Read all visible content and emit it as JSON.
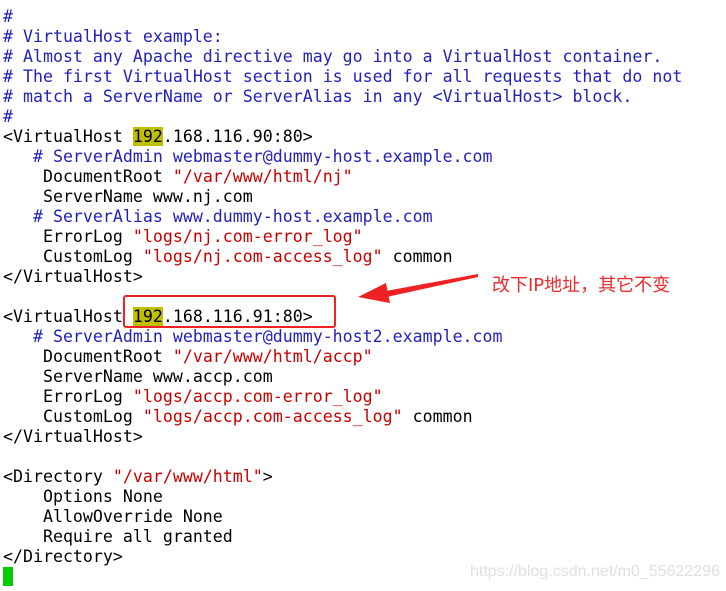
{
  "colors": {
    "comment": "#2222bb",
    "string": "#c80000",
    "highlight": "#c0c000",
    "cursor": "#00cc00",
    "annotation": "#ee2222"
  },
  "editor": {
    "lines": [
      [
        {
          "t": "#",
          "c": "comment"
        }
      ],
      [
        {
          "t": "# VirtualHost example:",
          "c": "comment"
        }
      ],
      [
        {
          "t": "# Almost any Apache directive may go into a VirtualHost container.",
          "c": "comment"
        }
      ],
      [
        {
          "t": "# The first VirtualHost section is used for all requests that do not",
          "c": "comment"
        }
      ],
      [
        {
          "t": "# match a ServerName or ServerAlias in any <VirtualHost> block.",
          "c": "comment"
        }
      ],
      [
        {
          "t": "#",
          "c": "comment"
        }
      ],
      [
        {
          "t": "<VirtualHost ",
          "c": "normal"
        },
        {
          "t": "192",
          "c": "hl"
        },
        {
          "t": ".168.116.90:80>",
          "c": "normal"
        }
      ],
      [
        {
          "t": "   # ServerAdmin webmaster@dummy-host.example.com",
          "c": "comment"
        }
      ],
      [
        {
          "t": "    DocumentRoot ",
          "c": "normal"
        },
        {
          "t": "\"/var/www/html/nj\"",
          "c": "string"
        }
      ],
      [
        {
          "t": "    ServerName www.nj.com",
          "c": "normal"
        }
      ],
      [
        {
          "t": "   # ServerAlias www.dummy-host.example.com",
          "c": "comment"
        }
      ],
      [
        {
          "t": "    ErrorLog ",
          "c": "normal"
        },
        {
          "t": "\"logs/nj.com-error_log\"",
          "c": "string"
        }
      ],
      [
        {
          "t": "    CustomLog ",
          "c": "normal"
        },
        {
          "t": "\"logs/nj.com-access_log\"",
          "c": "string"
        },
        {
          "t": " common",
          "c": "normal"
        }
      ],
      [
        {
          "t": "</VirtualHost>",
          "c": "normal"
        }
      ],
      [],
      [
        {
          "t": "<VirtualHost ",
          "c": "normal"
        },
        {
          "t": "192",
          "c": "hl"
        },
        {
          "t": ".168.116.91:80>",
          "c": "normal"
        }
      ],
      [
        {
          "t": "   # ServerAdmin webmaster@dummy-host2.example.com",
          "c": "comment"
        }
      ],
      [
        {
          "t": "    DocumentRoot ",
          "c": "normal"
        },
        {
          "t": "\"/var/www/html/accp\"",
          "c": "string"
        }
      ],
      [
        {
          "t": "    ServerName www.accp.com",
          "c": "normal"
        }
      ],
      [
        {
          "t": "    ErrorLog ",
          "c": "normal"
        },
        {
          "t": "\"logs/accp.com-error_log\"",
          "c": "string"
        }
      ],
      [
        {
          "t": "    CustomLog ",
          "c": "normal"
        },
        {
          "t": "\"logs/accp.com-access_log\"",
          "c": "string"
        },
        {
          "t": " common",
          "c": "normal"
        }
      ],
      [
        {
          "t": "</VirtualHost>",
          "c": "normal"
        }
      ],
      [],
      [
        {
          "t": "<Directory ",
          "c": "normal"
        },
        {
          "t": "\"/var/www/html\"",
          "c": "string"
        },
        {
          "t": ">",
          "c": "normal"
        }
      ],
      [
        {
          "t": "    Options None",
          "c": "normal"
        }
      ],
      [
        {
          "t": "    AllowOverride None",
          "c": "normal"
        }
      ],
      [
        {
          "t": "    Require all granted",
          "c": "normal"
        }
      ],
      [
        {
          "t": "</Directory>",
          "c": "normal"
        }
      ]
    ]
  },
  "annotation": {
    "text": "改下IP地址，其它不变"
  },
  "watermark": "https://blog.csdn.net/m0_55622296"
}
